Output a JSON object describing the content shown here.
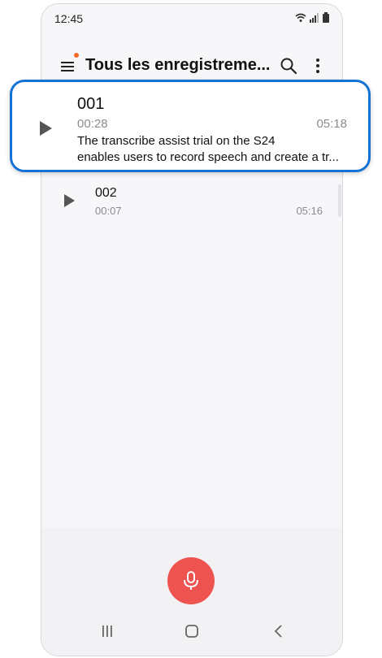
{
  "status_bar": {
    "time": "12:45"
  },
  "app_bar": {
    "title": "Tous les enregistreme..."
  },
  "recordings": [
    {
      "title": "001",
      "duration": "00:28",
      "time": "05:18",
      "transcript_line1": "The transcribe assist trial on the S24",
      "transcript_line2": "enables users to record speech and create a tr..."
    },
    {
      "title": "002",
      "duration": "00:07",
      "time": "05:16"
    }
  ],
  "colors": {
    "highlight_border": "#1673d6",
    "record_button": "#ef5350",
    "notification_dot": "#ef6b2a"
  },
  "icons": {
    "menu": "menu-icon",
    "search": "search-icon",
    "more": "more-vertical-icon",
    "play": "play-icon",
    "record": "microphone-icon",
    "nav_recent": "recent-apps-icon",
    "nav_home": "home-icon",
    "nav_back": "back-icon"
  }
}
